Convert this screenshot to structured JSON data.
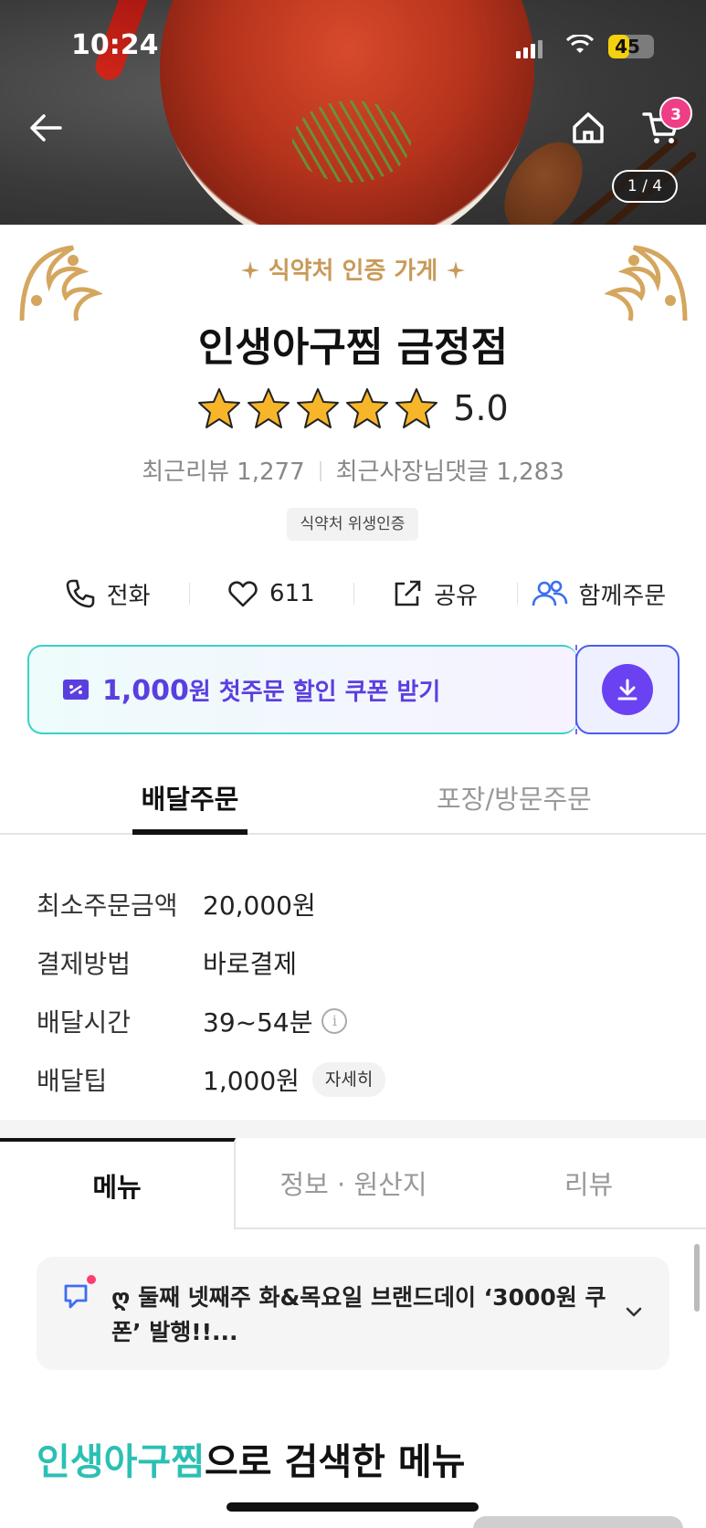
{
  "status_bar": {
    "time": "10:24",
    "battery": "45",
    "battery_level": 0.45
  },
  "header": {
    "cart_count": "3",
    "image_indicator": "1 / 4"
  },
  "store": {
    "cert_heading": "식약처 인증 가게",
    "name": "인생아구찜 금정점",
    "rating": "5.0",
    "star_count": 5,
    "recent_reviews": "최근리뷰 1,277",
    "recent_owner_replies": "최근사장님댓글 1,283",
    "hygiene_badge": "식약처 위생인증"
  },
  "actions": {
    "call": "전화",
    "likes": "611",
    "share": "공유",
    "group_order": "함께주문"
  },
  "coupon": {
    "amount": "1,000",
    "text": "원 첫주문 할인 쿠폰 받기"
  },
  "order_tabs": {
    "delivery": "배달주문",
    "pickup": "포장/방문주문"
  },
  "delivery_info": {
    "min_order_label": "최소주문금액",
    "min_order_value": "20,000원",
    "payment_label": "결제방법",
    "payment_value": "바로결제",
    "time_label": "배달시간",
    "time_value": "39~54분",
    "tip_label": "배달팁",
    "tip_value": "1,000원",
    "tip_detail": "자세히"
  },
  "content_tabs": {
    "menu": "메뉴",
    "info": "정보 · 원산지",
    "reviews": "리뷰"
  },
  "notice": {
    "text": "ღ 둘째 넷째주 화&목요일 브랜드데이 ‘3000원 쿠폰’ 발행!!..."
  },
  "search_section": {
    "highlight": "인생아구찜",
    "rest": "으로 검색한 메뉴"
  },
  "colors": {
    "accent_teal": "#2bc0b4",
    "coupon_purple": "#6a42f2",
    "badge_pink": "#ee3e86",
    "gold": "#c89a58"
  },
  "icons": [
    "back-icon",
    "home-icon",
    "cart-icon",
    "phone-icon",
    "heart-icon",
    "share-icon",
    "group-icon",
    "coupon-icon",
    "download-icon",
    "info-icon",
    "notice-icon",
    "chevron-down-icon",
    "star-icon"
  ]
}
